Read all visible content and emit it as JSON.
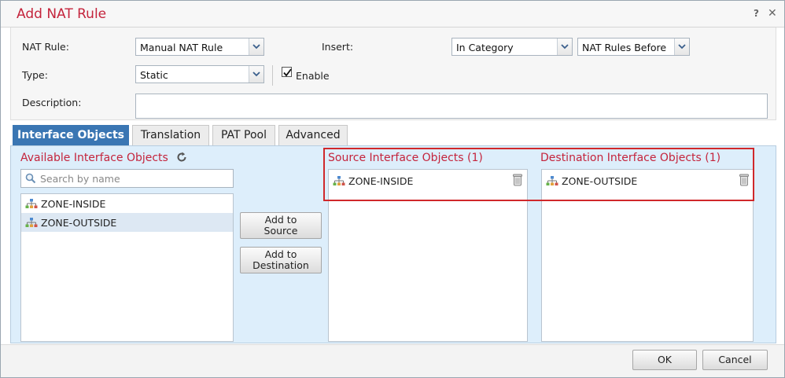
{
  "dialog": {
    "title": "Add NAT Rule",
    "help_glyph": "?",
    "close_glyph": "✕"
  },
  "form": {
    "nat_rule": {
      "label": "NAT Rule:",
      "value": "Manual NAT Rule"
    },
    "insert": {
      "label": "Insert:",
      "value": "In Category",
      "position_value": "NAT Rules Before"
    },
    "type": {
      "label": "Type:",
      "value": "Static"
    },
    "enable": {
      "label": "Enable",
      "checked": true
    },
    "description": {
      "label": "Description:",
      "value": ""
    }
  },
  "tabs": [
    {
      "label": "Interface Objects",
      "active": true
    },
    {
      "label": "Translation",
      "active": false
    },
    {
      "label": "PAT Pool",
      "active": false
    },
    {
      "label": "Advanced",
      "active": false
    }
  ],
  "available": {
    "title": "Available Interface Objects",
    "search_placeholder": "Search by name",
    "items": [
      {
        "label": "ZONE-INSIDE",
        "selected": false
      },
      {
        "label": "ZONE-OUTSIDE",
        "selected": true
      }
    ]
  },
  "actions": {
    "add_to_source_line1": "Add to",
    "add_to_source_line2": "Source",
    "add_to_destination_line1": "Add to",
    "add_to_destination_line2": "Destination"
  },
  "source": {
    "title": "Source Interface Objects (1)",
    "items": [
      {
        "label": "ZONE-INSIDE"
      }
    ]
  },
  "destination": {
    "title": "Destination Interface Objects (1)",
    "items": [
      {
        "label": "ZONE-OUTSIDE"
      }
    ]
  },
  "footer": {
    "ok_label": "OK",
    "cancel_label": "Cancel"
  },
  "colors": {
    "title": "#c4243c",
    "active_tab": "#3a76b3",
    "panel": "#ddeefb",
    "highlight": "#d0282b"
  },
  "icons": {
    "network": "network-icon",
    "delete": "trash-icon",
    "refresh": "refresh-icon",
    "search": "search-icon"
  }
}
